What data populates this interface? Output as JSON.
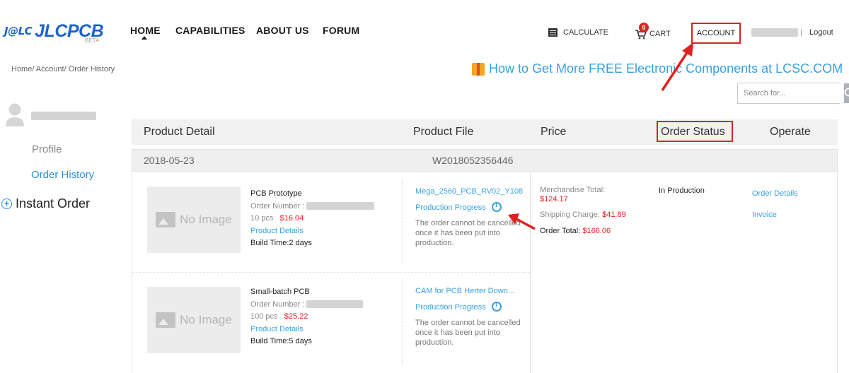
{
  "header": {
    "logo_badge": "J@LC",
    "logo_text": "JLCPCB",
    "logo_beta": "BETA",
    "nav": [
      "HOME",
      "CAPABILITIES",
      "ABOUT US",
      "FORUM"
    ],
    "calculate": "CALCULATE",
    "cart_count": "0",
    "cart": "CART",
    "account": "ACCOUNT",
    "separator": "|",
    "logout": "Logout"
  },
  "breadcrumb": "Home/ Account/ Order History",
  "promo": "How to Get More FREE Electronic Components at LCSC.COM",
  "search": {
    "placeholder": "Search for..."
  },
  "sidebar": {
    "profile": "Profile",
    "order_history": "Order History",
    "instant_order": "Instant Order",
    "plus": "+"
  },
  "table": {
    "headers": [
      "Product Detail",
      "Product File",
      "Price",
      "Order Status",
      "Operate"
    ],
    "order": {
      "date": "2018-05-23",
      "number": "W2018052356446",
      "merchandise_label": "Merchandise Total:",
      "merchandise_value": "$124.17",
      "shipping_label": "Shipping Charge:",
      "shipping_value": "$41.89",
      "total_label": "Order Total:",
      "total_value": "$166.06",
      "status": "In Production",
      "op_details": "Order Details",
      "op_invoice": "Invoice",
      "items": [
        {
          "no_image": "No Image",
          "name": "PCB Prototype",
          "order_number_label": "Order Number :",
          "qty": "10 pcs",
          "price": "$16.04",
          "details": "Product Details",
          "build_time": "Build Time:2 days",
          "file": "Mega_2560_PCB_RV02_Y108",
          "progress": "Production Progress",
          "note": "The order cannot be cancelled once it has been put into production."
        },
        {
          "no_image": "No Image",
          "name": "Small-batch PCB",
          "order_number_label": "Order Number :",
          "qty": "100 pcs",
          "price": "$25.22",
          "details": "Product Details",
          "build_time": "Build Time:5 days",
          "file": "CAM for PCB Herter Down...",
          "progress": "Production Progress",
          "note": "The order cannot be cancelled once it has been put into production."
        }
      ]
    }
  },
  "colors": {
    "brand": "#1e63c9",
    "link": "#3aa0e0",
    "highlight": "#e02020"
  }
}
